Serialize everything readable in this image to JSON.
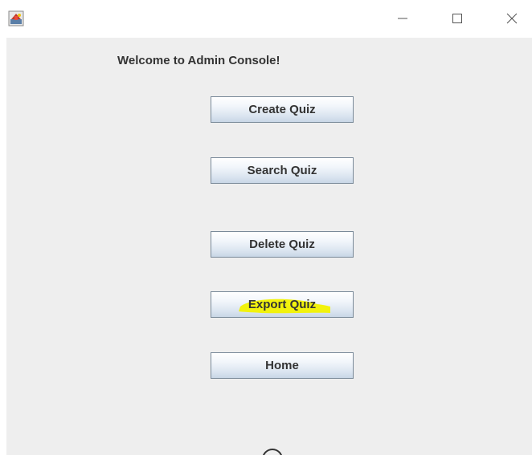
{
  "window": {
    "icon": "java-app-icon",
    "controls": [
      "minimize-icon",
      "maximize-icon",
      "close-icon"
    ]
  },
  "main": {
    "welcome_text": "Welcome to Admin Console!",
    "buttons": {
      "create_quiz": "Create Quiz",
      "search_quiz": "Search Quiz",
      "delete_quiz": "Delete Quiz",
      "export_quiz": "Export Quiz",
      "home": "Home"
    },
    "highlight_color": "#f2f200"
  },
  "colors": {
    "background": "#eeeeee",
    "button_border": "#7a8a99",
    "text": "#333333"
  }
}
